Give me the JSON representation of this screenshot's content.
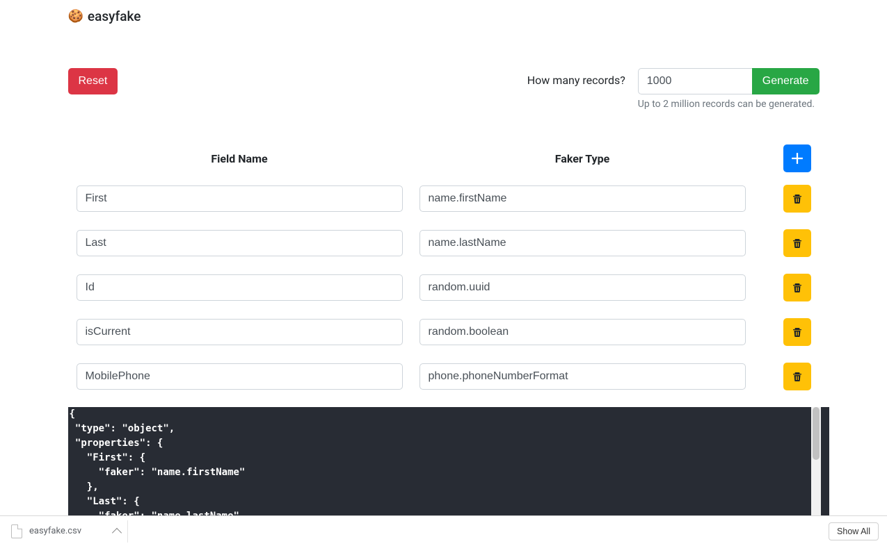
{
  "app": {
    "cookie_icon": "🍪",
    "title": "easyfake"
  },
  "toolbar": {
    "reset_label": "Reset",
    "records_label": "How many records?",
    "records_value": "1000",
    "generate_label": "Generate",
    "help_text": "Up to 2 million records can be generated."
  },
  "table": {
    "header_field": "Field Name",
    "header_type": "Faker Type",
    "rows": [
      {
        "field": "First",
        "type": "name.firstName"
      },
      {
        "field": "Last",
        "type": "name.lastName"
      },
      {
        "field": "Id",
        "type": "random.uuid"
      },
      {
        "field": "isCurrent",
        "type": "random.boolean"
      },
      {
        "field": "MobilePhone",
        "type": "phone.phoneNumberFormat"
      }
    ]
  },
  "code_preview": "{\n \"type\": \"object\",\n \"properties\": {\n   \"First\": {\n     \"faker\": \"name.firstName\"\n   },\n   \"Last\": {\n     \"faker\": \"name.lastName\"",
  "downloads": {
    "file_name": "easyfake.csv",
    "show_all_label": "Show All"
  }
}
